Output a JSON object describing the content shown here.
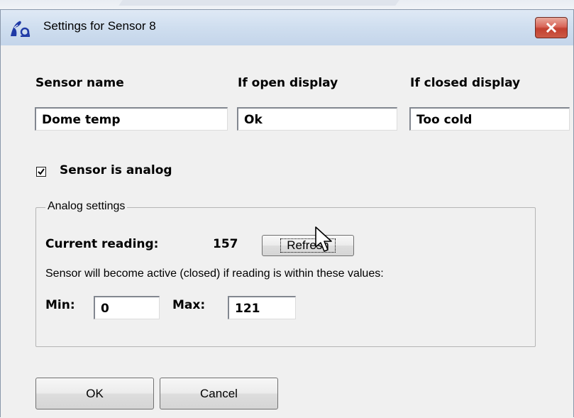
{
  "window": {
    "title": "Settings for Sensor 8",
    "close_icon": "close-x-icon",
    "app_icon": "app-logo-icon"
  },
  "columns": {
    "sensor_name_label": "Sensor name",
    "open_display_label": "If open display",
    "closed_display_label": "If closed display"
  },
  "fields": {
    "sensor_name": "Dome temp",
    "open_display": "Ok",
    "closed_display": "Too cold"
  },
  "analog_checkbox": {
    "label": "Sensor is analog",
    "checked": true
  },
  "analog_settings": {
    "legend": "Analog settings",
    "current_reading_label": "Current reading:",
    "current_reading_value": "157",
    "refresh_label": "Refresh",
    "description": "Sensor will become active (closed) if reading is within these values:",
    "min_label": "Min:",
    "min_value": "0",
    "max_label": "Max:",
    "max_value": "121"
  },
  "buttons": {
    "ok_label": "OK",
    "cancel_label": "Cancel"
  },
  "colors": {
    "close_button": "#c94c3c",
    "titlebar": "#cfdeef",
    "dialog_bg": "#f0f0f0"
  }
}
